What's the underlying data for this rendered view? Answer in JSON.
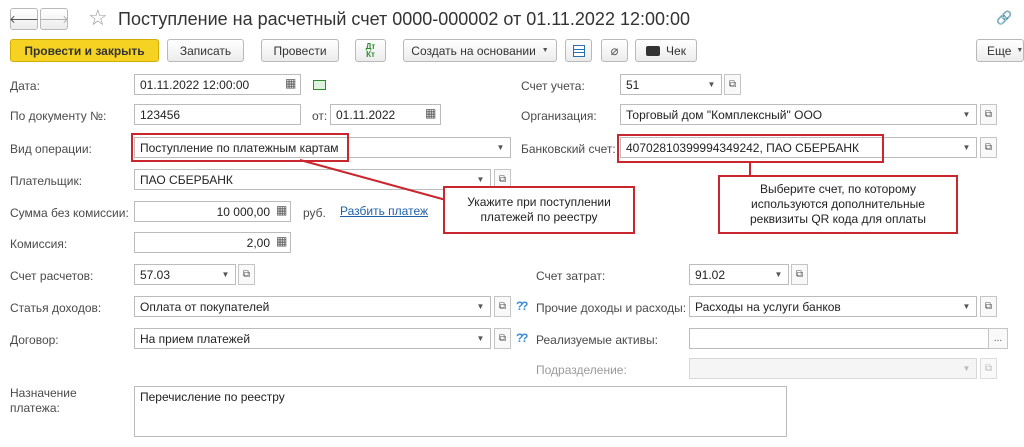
{
  "header": {
    "back": "🡐",
    "forward": "🡒",
    "star": "☆",
    "title": "Поступление на расчетный счет 0000-000002 от 01.11.2022 12:00:00",
    "more_menu": "⋮",
    "close": "×",
    "link": "🔗"
  },
  "toolbar": {
    "post_close": "Провести и закрыть",
    "save": "Записать",
    "post": "Провести",
    "dt_kt": "Дт\nКт",
    "create_based": "Создать на основании",
    "check": "Чек",
    "more": "Еще",
    "more_q": "?"
  },
  "form": {
    "date_label": "Дата:",
    "date_value": "01.11.2022 12:00:00",
    "doc_no_label": "По документу №:",
    "doc_no_value": "123456",
    "from_label": "от:",
    "from_value": "01.11.2022",
    "op_type_label": "Вид операции:",
    "op_type_value": "Поступление по платежным картам",
    "payer_label": "Плательщик:",
    "payer_value": "ПАО СБЕРБАНК",
    "sum_label": "Сумма без комиссии:",
    "sum_value": "10 000,00",
    "rub": "руб.",
    "split_link": "Разбить платеж",
    "commission_label": "Комиссия:",
    "commission_value": "2,00",
    "settle_acc_label": "Счет расчетов:",
    "settle_acc_value": "57.03",
    "income_item_label": "Статья доходов:",
    "income_item_value": "Оплата от покупателей",
    "contract_label": "Договор:",
    "contract_value": "На прием платежей",
    "purpose_label": "Назначение\nплатежа:",
    "purpose_value": "Перечисление по реестру",
    "account_label": "Счет учета:",
    "account_value": "51",
    "org_label": "Организация:",
    "org_value": "Торговый дом \"Комплексный\" ООО",
    "bank_acc_label": "Банковский счет:",
    "bank_acc_value": "40702810399994349242, ПАО СБЕРБАНК",
    "cost_acc_label": "Счет затрат:",
    "cost_acc_value": "91.02",
    "other_label": "Прочие доходы и расходы:",
    "other_value": "Расходы на услуги банков",
    "assets_label": "Реализуемые активы:",
    "assets_value": "",
    "division_label": "Подразделение:",
    "division_value": ""
  },
  "callouts": {
    "left": "Укажите при поступлении платежей по реестру",
    "right": "Выберите счет, по которому используются дополнительные реквизиты QR кода для оплаты"
  },
  "glyphs": {
    "dropdown": "▼",
    "open": "⧉",
    "ellipsis": "...",
    "calendar": "▦",
    "calc": "▦",
    "question": "?"
  }
}
